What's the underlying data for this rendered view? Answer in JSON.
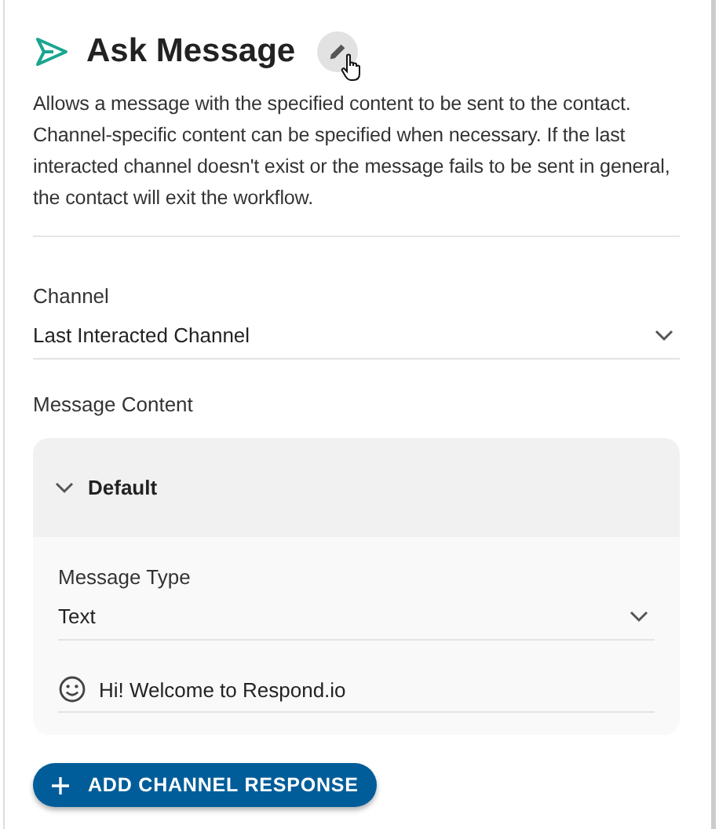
{
  "header": {
    "title": "Ask Message",
    "description": "Allows a message with the specified content to be sent to the contact. Channel-specific content can be specified when necessary. If the last interacted channel doesn't exist or the message fails to be sent in general, the contact will exit the workflow."
  },
  "channel": {
    "label": "Channel",
    "value": "Last Interacted Channel"
  },
  "message_content": {
    "label": "Message Content",
    "sections": [
      {
        "title": "Default",
        "expanded": true,
        "type_label": "Message Type",
        "type_value": "Text",
        "message": "Hi! Welcome to Respond.io"
      }
    ]
  },
  "add_button": {
    "label": "ADD CHANNEL RESPONSE"
  }
}
